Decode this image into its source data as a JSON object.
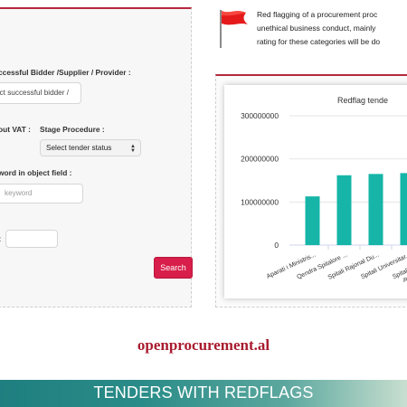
{
  "form": {
    "bidder_label": "ccessful Bidder /Supplier / Provider :",
    "bidder_placeholder": "ect successful bidder /",
    "vat_label": "out VAT :",
    "stage_label": "Stage Procedure :",
    "stage_select": "Select tender status",
    "keyword_label": "word in object field :",
    "keyword_placeholder": "keyword",
    "misc_label": ":",
    "search_button": "Search"
  },
  "description": {
    "line1": "Red flagging of a procurement proc",
    "line2": "unethical business conduct, mainly",
    "line3": "rating for these categories will be do"
  },
  "chart_data": {
    "type": "bar",
    "title": "Redflag tende",
    "categories": [
      "Aparati i Ministris...",
      "Qendra Spitalore ...",
      "Spitali Rajonal Du...",
      "Spitali Universitar...",
      "Spitali Universitar..."
    ],
    "values": [
      113000000,
      162000000,
      165000000,
      167000000,
      167000000
    ],
    "yticks": [
      "300000000",
      "200000000",
      "100000000",
      "0"
    ],
    "ylim": [
      0,
      300000000
    ],
    "bar_color": "#16b5a8",
    "partial_label": "P"
  },
  "footer": {
    "site": "openprocurement.al",
    "banner": "TENDERS WITH REDFLAGS"
  },
  "colors": {
    "accent": "#b5283f",
    "button": "#d81e4a",
    "banner": "#1f7f80"
  }
}
